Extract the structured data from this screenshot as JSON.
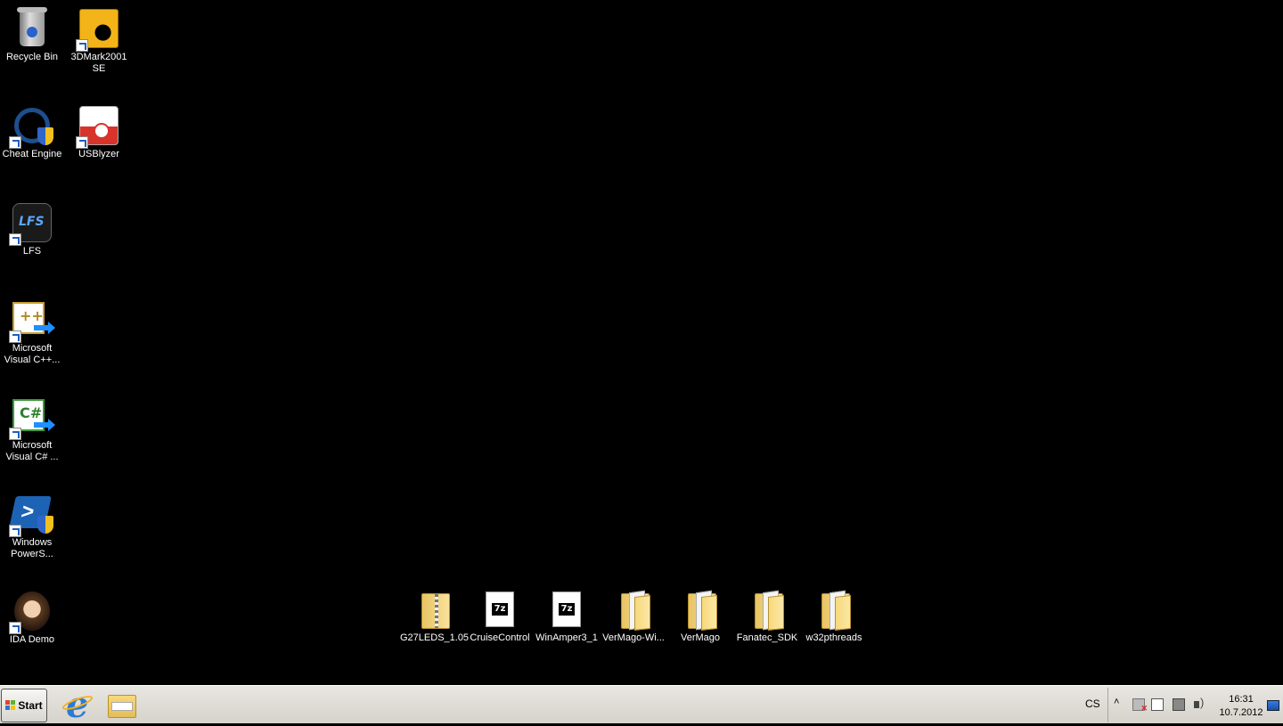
{
  "desktop": {
    "left_icons": [
      {
        "label": "Recycle Bin",
        "icon": "recycle-bin-icon"
      },
      {
        "label": "3DMark2001 SE",
        "icon": "3dmark-icon"
      },
      {
        "label": "Cheat Engine",
        "icon": "cheat-engine-icon"
      },
      {
        "label": "USBlyzer",
        "icon": "usblyzer-icon"
      },
      {
        "label": "LFS",
        "icon": "lfs-icon"
      },
      {
        "label": "Microsoft Visual C++...",
        "icon": "visual-cpp-icon"
      },
      {
        "label": "Microsoft Visual C# ...",
        "icon": "visual-csharp-icon"
      },
      {
        "label": "Windows PowerS...",
        "icon": "powershell-icon"
      },
      {
        "label": "IDA Demo",
        "icon": "ida-icon"
      }
    ],
    "bottom_icons": [
      {
        "label": "G27LEDS_1.05",
        "icon": "zip-folder-icon"
      },
      {
        "label": "CruiseControl",
        "icon": "7z-archive-icon"
      },
      {
        "label": "WinAmper3_1",
        "icon": "7z-archive-icon"
      },
      {
        "label": "VerMago-Wi...",
        "icon": "folder-icon"
      },
      {
        "label": "VerMago",
        "icon": "folder-icon"
      },
      {
        "label": "Fanatec_SDK",
        "icon": "folder-icon"
      },
      {
        "label": "w32pthreads",
        "icon": "folder-icon"
      }
    ]
  },
  "taskbar": {
    "start_label": "Start",
    "language": "CS",
    "tray_chevron": "˄",
    "clock_time": "16:31",
    "clock_date": "10.7.2012"
  }
}
